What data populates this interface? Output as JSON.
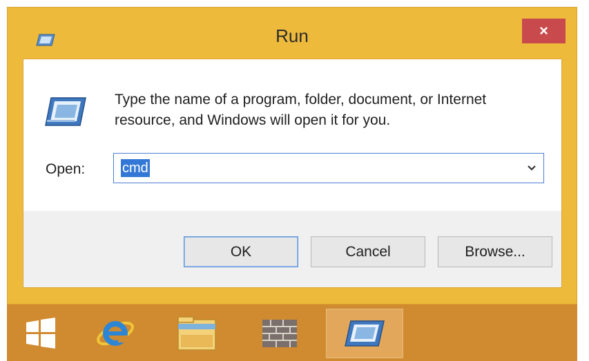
{
  "window": {
    "title": "Run",
    "close_glyph": "×",
    "title_icon": "run-icon",
    "close_color": "#c84a4d",
    "frame_color": "#eeba3c"
  },
  "dialog": {
    "description": "Type the name of a program, folder, document, or Internet resource, and Windows will open it for you.",
    "open_label": "Open:",
    "open_value": "cmd",
    "buttons": {
      "ok": "OK",
      "cancel": "Cancel",
      "browse": "Browse..."
    }
  },
  "taskbar": {
    "color": "#d08a2f",
    "items": [
      {
        "icon": "windows-start-icon",
        "active": false
      },
      {
        "icon": "internet-explorer-icon",
        "active": false
      },
      {
        "icon": "file-explorer-icon",
        "active": false
      },
      {
        "icon": "firewall-icon",
        "active": false
      },
      {
        "icon": "run-icon",
        "active": true
      }
    ]
  }
}
